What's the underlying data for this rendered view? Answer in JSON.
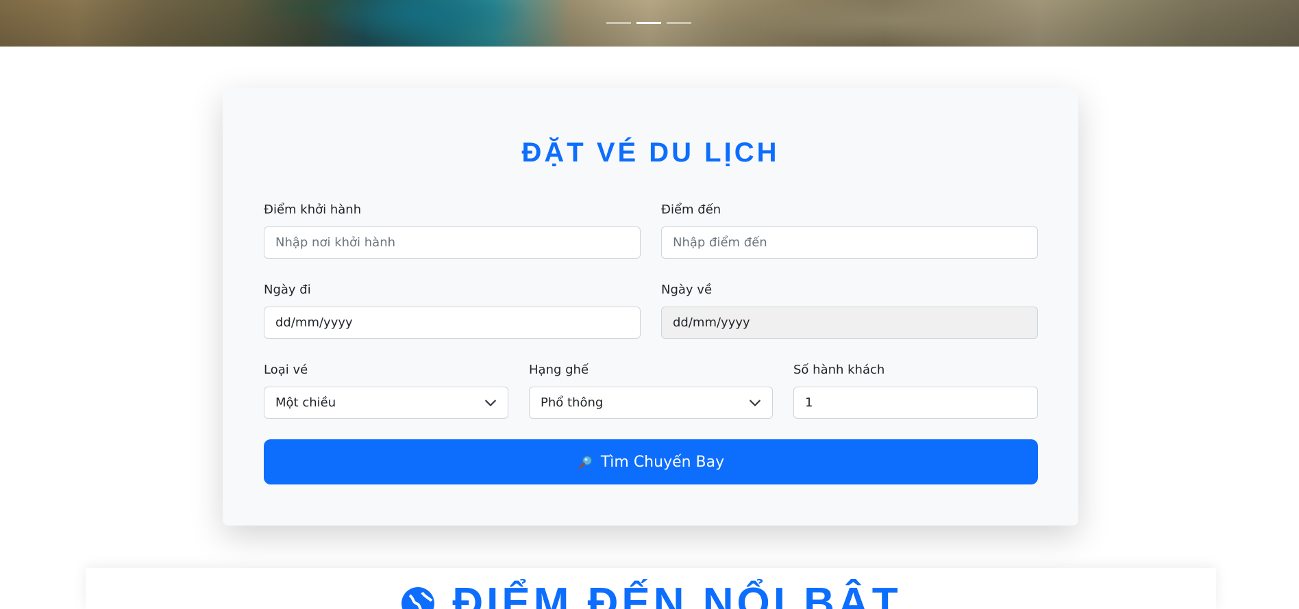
{
  "hero": {
    "indicators": [
      false,
      true,
      false
    ]
  },
  "booking": {
    "title": "ĐẶT VÉ DU LỊCH",
    "origin": {
      "label": "Điểm khởi hành",
      "placeholder": "Nhập nơi khởi hành"
    },
    "destination": {
      "label": "Điểm đến",
      "placeholder": "Nhập điểm đến"
    },
    "depart_date": {
      "label": "Ngày đi",
      "value": "dd/mm/yyyy"
    },
    "return_date": {
      "label": "Ngày về",
      "value": "dd/mm/yyyy",
      "disabled": true
    },
    "ticket_type": {
      "label": "Loại vé",
      "selected": "Một chiều"
    },
    "seat_class": {
      "label": "Hạng ghế",
      "selected": "Phổ thông"
    },
    "passengers": {
      "label": "Số hành khách",
      "value": "1"
    },
    "search_button": "Tìm Chuyến Bay",
    "accent_color": "#0d6efd"
  },
  "featured": {
    "title": "ĐIỂM ĐẾN NỔI BẬT"
  }
}
